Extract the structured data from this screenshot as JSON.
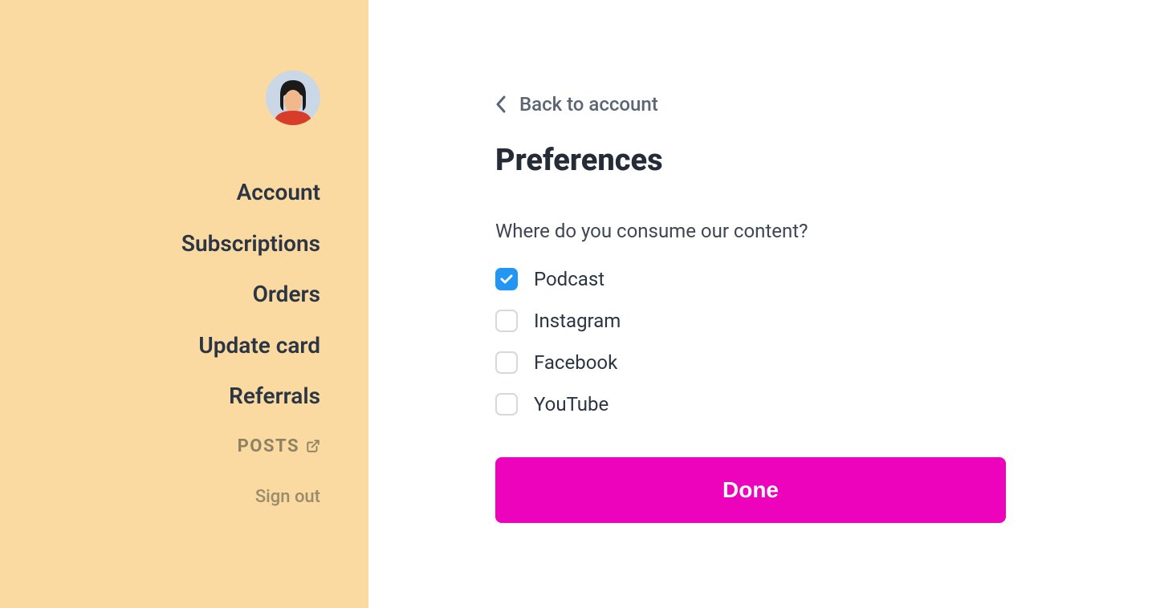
{
  "sidebar": {
    "nav": [
      {
        "label": "Account"
      },
      {
        "label": "Subscriptions"
      },
      {
        "label": "Orders"
      },
      {
        "label": "Update card"
      },
      {
        "label": "Referrals"
      }
    ],
    "posts_label": "POSTS",
    "signout_label": "Sign out"
  },
  "main": {
    "back_label": "Back to account",
    "title": "Preferences",
    "question": "Where do you consume our content?",
    "options": [
      {
        "label": "Podcast",
        "checked": true
      },
      {
        "label": "Instagram",
        "checked": false
      },
      {
        "label": "Facebook",
        "checked": false
      },
      {
        "label": "YouTube",
        "checked": false
      }
    ],
    "done_label": "Done"
  },
  "colors": {
    "sidebar_bg": "#fadaa0",
    "accent": "#ec03bb",
    "checkbox_checked": "#2196f3"
  }
}
